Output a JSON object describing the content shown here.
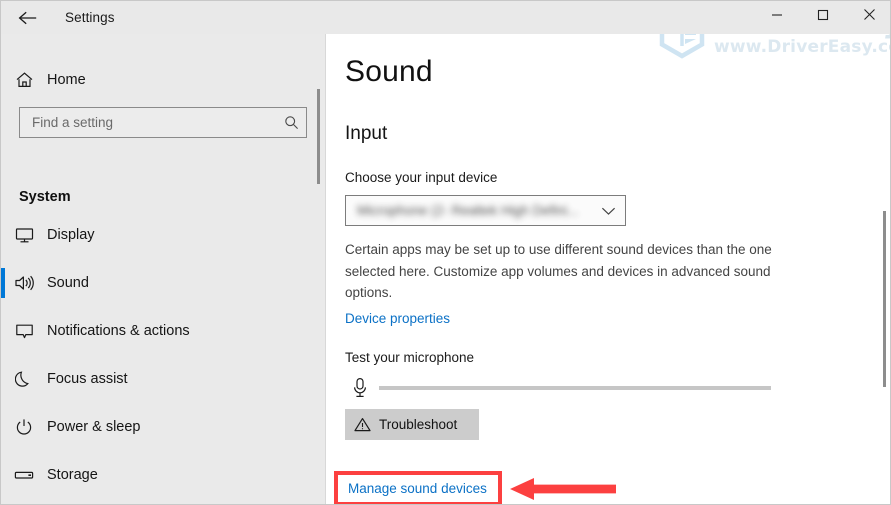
{
  "window": {
    "app_title": "Settings",
    "back_icon": "back-arrow-icon",
    "controls": {
      "minimize": "minimize-icon",
      "maximize": "maximize-icon",
      "close": "close-icon"
    }
  },
  "watermark": {
    "brand": "driver easy",
    "url": "www.DriverEasy.com",
    "logo": "drivereasy-hexagon-logo"
  },
  "sidebar": {
    "home_label": "Home",
    "home_icon": "home-icon",
    "search": {
      "placeholder": "Find a setting",
      "value": "",
      "icon": "search-icon"
    },
    "section_title": "System",
    "items": [
      {
        "label": "Display",
        "icon": "monitor-icon",
        "selected": false
      },
      {
        "label": "Sound",
        "icon": "speaker-icon",
        "selected": true
      },
      {
        "label": "Notifications & actions",
        "icon": "notification-icon",
        "selected": false
      },
      {
        "label": "Focus assist",
        "icon": "moon-icon",
        "selected": false
      },
      {
        "label": "Power & sleep",
        "icon": "power-icon",
        "selected": false
      },
      {
        "label": "Storage",
        "icon": "drive-icon",
        "selected": false
      }
    ]
  },
  "main": {
    "page_title": "Sound",
    "input_heading": "Input",
    "choose_device_label": "Choose your input device",
    "device_value": "Microphone (2- Realtek High Defini...",
    "chevron_icon": "chevron-down-icon",
    "description": "Certain apps may be set up to use different sound devices than the one selected here. Customize app volumes and devices in advanced sound options.",
    "device_properties_link": "Device properties",
    "test_microphone_label": "Test your microphone",
    "mic_icon": "microphone-icon",
    "mic_level_percent": 0,
    "troubleshoot_label": "Troubleshoot",
    "troubleshoot_icon": "warning-triangle-icon",
    "manage_sound_devices_link": "Manage sound devices"
  },
  "annotation": {
    "highlight_color": "#fc4040",
    "arrow_icon": "left-arrow-annotation"
  },
  "colors": {
    "accent": "#0078d7",
    "link": "#0b71c6",
    "sidebar_bg": "#eaeaea",
    "titlebar_bg": "#e9e9e9",
    "annotation_red": "#fc4040"
  }
}
